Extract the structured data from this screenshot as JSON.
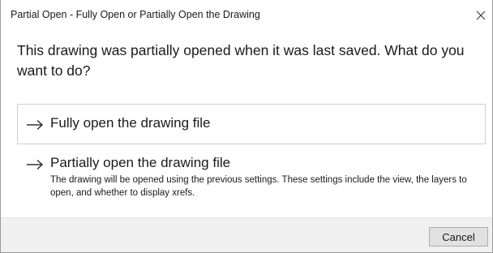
{
  "window": {
    "title": "Partial Open - Fully Open or Partially Open the Drawing",
    "close_icon": "close-icon"
  },
  "question": "This drawing was partially opened when it was last saved. What do you want to do?",
  "options": [
    {
      "icon": "arrow-right-icon",
      "label": "Fully open the drawing file",
      "description": ""
    },
    {
      "icon": "arrow-right-icon",
      "label": "Partially open the drawing file",
      "description": "The drawing will be opened using the previous settings. These settings include the view, the layers to open, and whether to display xrefs."
    }
  ],
  "footer": {
    "cancel_label": "Cancel"
  },
  "colors": {
    "footer_bg": "#f0f0f0",
    "button_bg": "#e1e1e1",
    "option_border": "#cfcfcf",
    "text": "#1a1a1a"
  }
}
